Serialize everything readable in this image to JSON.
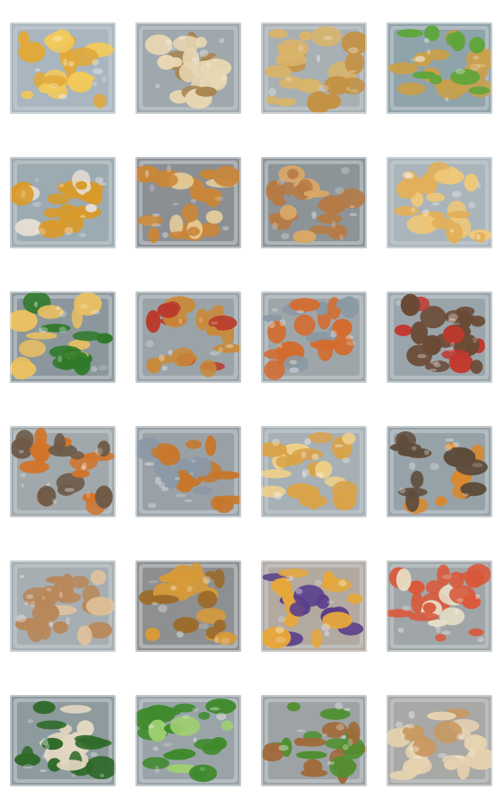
{
  "gallery": {
    "rows": 6,
    "columns": 4,
    "tiles": [
      {
        "id": "fried-chicken-pieces",
        "colors": {
          "bg": "#a9b6bf",
          "food": "#e0a93a",
          "accent": "#f2c95b"
        }
      },
      {
        "id": "fried-bean-sprouts",
        "colors": {
          "bg": "#9fa8ad",
          "food": "#e8d7b3",
          "accent": "#a88550"
        }
      },
      {
        "id": "fried-noodles",
        "colors": {
          "bg": "#a8b0b4",
          "food": "#d9b46a",
          "accent": "#c49142"
        }
      },
      {
        "id": "tofu-and-long-beans",
        "colors": {
          "bg": "#8fa3ab",
          "food": "#caa04a",
          "accent": "#5ea53a"
        }
      },
      {
        "id": "pumpkin-and-chicken",
        "colors": {
          "bg": "#9caab1",
          "food": "#d99a2a",
          "accent": "#e4ddd4"
        }
      },
      {
        "id": "braised-pork",
        "colors": {
          "bg": "#8b8f93",
          "food": "#c9863a",
          "accent": "#e7cf9a"
        }
      },
      {
        "id": "soy-chicken-drumsticks",
        "colors": {
          "bg": "#8c9498",
          "food": "#b57a45",
          "accent": "#d9a768"
        }
      },
      {
        "id": "fried-chicken-fillet",
        "colors": {
          "bg": "#aab5bb",
          "food": "#e2b05a",
          "accent": "#f0c878"
        }
      },
      {
        "id": "spinach-and-omelette",
        "colors": {
          "bg": "#8b979c",
          "food": "#2f7a2a",
          "accent": "#e9c062"
        }
      },
      {
        "id": "fried-chicken-and-sausage",
        "colors": {
          "bg": "#9aa3a8",
          "food": "#c98a3a",
          "accent": "#b93a2a"
        }
      },
      {
        "id": "curry-fish",
        "colors": {
          "bg": "#9ea6aa",
          "food": "#d46b2e",
          "accent": "#8a98a4"
        }
      },
      {
        "id": "eggplant-and-sausage",
        "colors": {
          "bg": "#9aa5ab",
          "food": "#6a4a35",
          "accent": "#c2382e"
        }
      },
      {
        "id": "sweet-sour-chicken-and-fish",
        "colors": {
          "bg": "#a0a8ac",
          "food": "#d2742a",
          "accent": "#6f5a48"
        }
      },
      {
        "id": "fish-steaks-in-sauce",
        "colors": {
          "bg": "#9aa1a6",
          "food": "#c7772a",
          "accent": "#8b98a6"
        }
      },
      {
        "id": "fried-fish",
        "colors": {
          "bg": "#a6b0b5",
          "food": "#d9a34a",
          "accent": "#f0d08a"
        }
      },
      {
        "id": "fish-and-sweet-sour-chicken",
        "colors": {
          "bg": "#97a2a8",
          "food": "#5e4c3c",
          "accent": "#d9882c"
        }
      },
      {
        "id": "whole-fried-fish",
        "colors": {
          "bg": "#a7aeb2",
          "food": "#b8875a",
          "accent": "#e2c49c"
        }
      },
      {
        "id": "fried-tofu-in-sauce",
        "colors": {
          "bg": "#8d8f90",
          "food": "#d89a38",
          "accent": "#9b6a2a"
        }
      },
      {
        "id": "purple-sweet-potato",
        "colors": {
          "bg": "#b2a9a0",
          "food": "#5a3e8c",
          "accent": "#e6a83a"
        }
      },
      {
        "id": "chili-and-cabbage",
        "colors": {
          "bg": "#a0a6a8",
          "food": "#d9583a",
          "accent": "#e8e2c8"
        }
      },
      {
        "id": "greens-and-mushrooms",
        "colors": {
          "bg": "#8d9a9e",
          "food": "#2f6a2a",
          "accent": "#e4d8c2"
        }
      },
      {
        "id": "stir-fried-greens",
        "colors": {
          "bg": "#9aa4a8",
          "food": "#3f8a2c",
          "accent": "#9fd070"
        }
      },
      {
        "id": "minced-meat-and-long-beans",
        "colors": {
          "bg": "#9da3a5",
          "food": "#a06a3a",
          "accent": "#4e8f2e"
        }
      },
      {
        "id": "stir-fried-cabbage",
        "colors": {
          "bg": "#a8a8a6",
          "food": "#e6d2b0",
          "accent": "#c89860"
        }
      }
    ]
  }
}
